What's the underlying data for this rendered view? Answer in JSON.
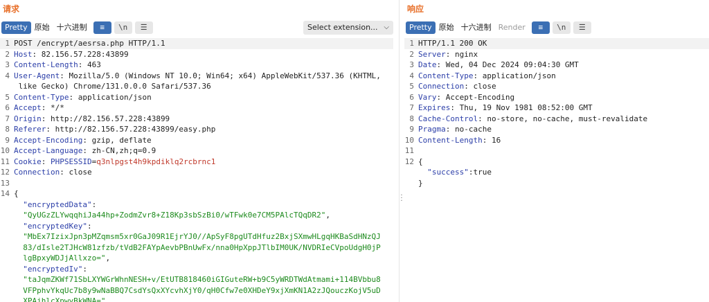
{
  "request": {
    "title": "请求",
    "tabs": [
      "Pretty",
      "原始",
      "十六进制"
    ],
    "buttons": [
      "≡",
      "\\n",
      "☰"
    ],
    "extension_select": "Select extension...",
    "lines": [
      {
        "n": "1",
        "text": "POST /encrypt/aesrsa.php HTTP/1.1"
      },
      {
        "n": "2",
        "key": "Host",
        "val": " 82.156.57.228:43899"
      },
      {
        "n": "3",
        "key": "Content-Length",
        "val": " 463"
      },
      {
        "n": "4",
        "key": "User-Agent",
        "val": " Mozilla/5.0 (Windows NT 10.0; Win64; x64) AppleWebKit/537.36 (KHTML,"
      },
      {
        "n": "",
        "text": " like Gecko) Chrome/131.0.0.0 Safari/537.36"
      },
      {
        "n": "5",
        "key": "Content-Type",
        "val": " application/json"
      },
      {
        "n": "6",
        "key": "Accept",
        "val": " */*"
      },
      {
        "n": "7",
        "key": "Origin",
        "val": " http://82.156.57.228:43899"
      },
      {
        "n": "8",
        "key": "Referer",
        "val": " http://82.156.57.228:43899/easy.php"
      },
      {
        "n": "9",
        "key": "Accept-Encoding",
        "val": " gzip, deflate"
      },
      {
        "n": "10",
        "key": "Accept-Language",
        "val": " zh-CN,zh;q=0.9"
      },
      {
        "n": "11",
        "key": "Cookie",
        "ckey": " PHPSESSID",
        "cval": "q3nlpgst4h9kpdiklq2rcbrnc1"
      },
      {
        "n": "12",
        "key": "Connection",
        "val": " close"
      },
      {
        "n": "13",
        "text": ""
      },
      {
        "n": "14",
        "text": "{"
      },
      {
        "n": "",
        "jkey": "  \"encryptedData\"",
        "text": ":"
      },
      {
        "n": "",
        "str": "  \"QyUGzZLYwqqhiJa44hp+ZodmZvr8+Z18Kp3sbSzBi0/wTFwk0e7CM5PAlcTQqDR2\"",
        "text": ","
      },
      {
        "n": "",
        "jkey": "  \"encryptedKey\"",
        "text": ":"
      },
      {
        "n": "",
        "str": "  \"MbEx7IzixJpn3pMZqmsm5xr0GaJ09R1EjrYJ0//ApSyF8pgUTdHfuz2BxjSXmwHLgqHKBaSdHNzQJ"
      },
      {
        "n": "",
        "str": "  83/dIsle2TJHcW81zfzb/tVdB2FAYpAevbPBnUwFx/nna0HpXppJTlbIM0UK/NVDRIeCVpoUdgH0jP"
      },
      {
        "n": "",
        "str": "  lgBpxyWDJjAllxzo=\"",
        "text": ","
      },
      {
        "n": "",
        "jkey": "  \"encryptedIv\"",
        "text": ":"
      },
      {
        "n": "",
        "str": "  \"taJqmZKWf71SbLXYWGrWhnNESH+v/EtUTB818460iGIGuteRW+b9C5yWRDTWdAtmami+114BVbbu8"
      },
      {
        "n": "",
        "str": "  VFPphvYkqUc7b8y9wNaBBQ7CsdYsQxXYcvhXjY0/qH0Cfw7e0XHDeY9xjXmKN1A2zJQouczKojV5uD"
      },
      {
        "n": "",
        "str": "  XPAjhlcXpwyBkWNA=\""
      }
    ]
  },
  "response": {
    "title": "响应",
    "tabs": [
      "Pretty",
      "原始",
      "十六进制",
      "Render"
    ],
    "buttons": [
      "≡",
      "\\n",
      "☰"
    ],
    "lines": [
      {
        "n": "1",
        "text": "HTTP/1.1 200 OK"
      },
      {
        "n": "2",
        "key": "Server",
        "val": " nginx"
      },
      {
        "n": "3",
        "key": "Date",
        "val": " Wed, 04 Dec 2024 09:04:30 GMT"
      },
      {
        "n": "4",
        "key": "Content-Type",
        "val": " application/json"
      },
      {
        "n": "5",
        "key": "Connection",
        "val": " close"
      },
      {
        "n": "6",
        "key": "Vary",
        "val": " Accept-Encoding"
      },
      {
        "n": "7",
        "key": "Expires",
        "val": " Thu, 19 Nov 1981 08:52:00 GMT"
      },
      {
        "n": "8",
        "key": "Cache-Control",
        "val": " no-store, no-cache, must-revalidate"
      },
      {
        "n": "9",
        "key": "Pragma",
        "val": " no-cache"
      },
      {
        "n": "10",
        "key": "Content-Length",
        "val": " 16"
      },
      {
        "n": "11",
        "text": ""
      },
      {
        "n": "12",
        "text": "{"
      },
      {
        "n": "",
        "jkey": "  \"success\"",
        "text": ":true"
      },
      {
        "n": "",
        "text": "}"
      }
    ]
  }
}
